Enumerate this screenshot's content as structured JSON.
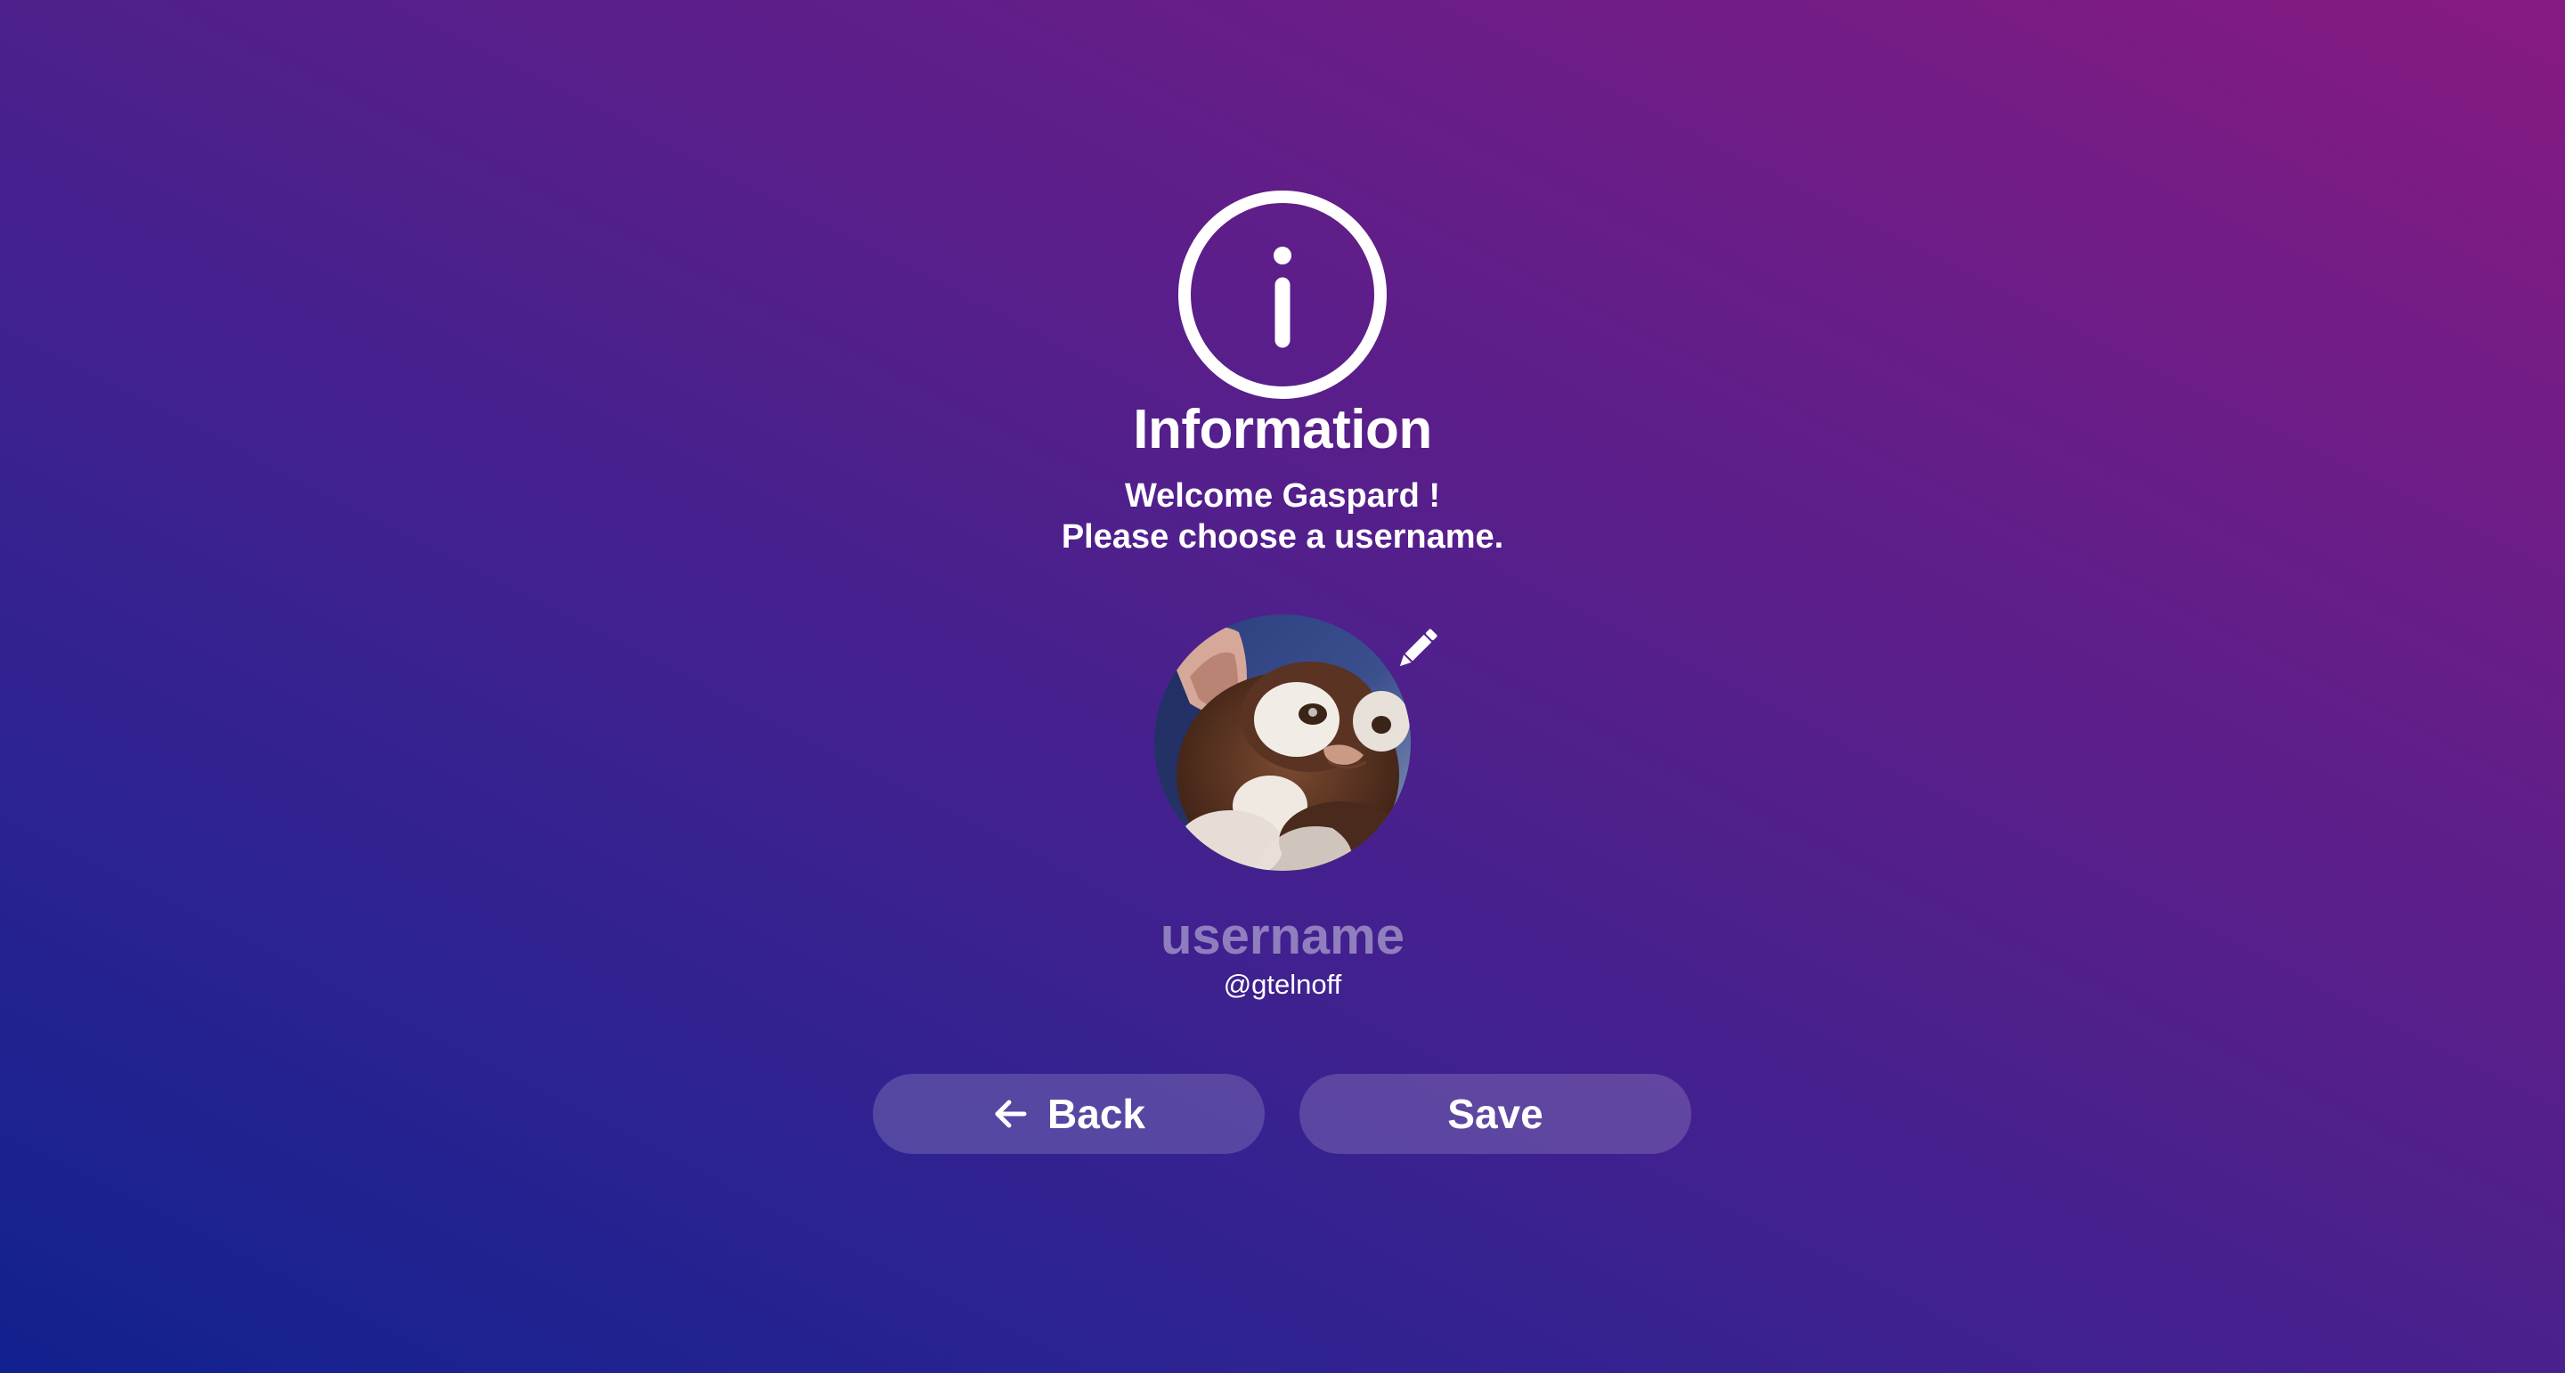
{
  "dialog": {
    "icon": "info-circle-icon",
    "title": "Information",
    "message_line1": "Welcome Gaspard !",
    "message_line2": "Please choose a username."
  },
  "profile": {
    "avatar_icon": "avatar-photo",
    "edit_icon": "pencil-icon",
    "username_value": "",
    "username_placeholder": "username",
    "handle": "@gtelnoff"
  },
  "actions": {
    "back_label": "Back",
    "back_icon": "arrow-left-icon",
    "save_label": "Save"
  },
  "colors": {
    "gradient_start": "#11218f",
    "gradient_end": "#871a82",
    "text": "#ffffff",
    "button_bg": "rgba(255,255,255,0.17)"
  }
}
